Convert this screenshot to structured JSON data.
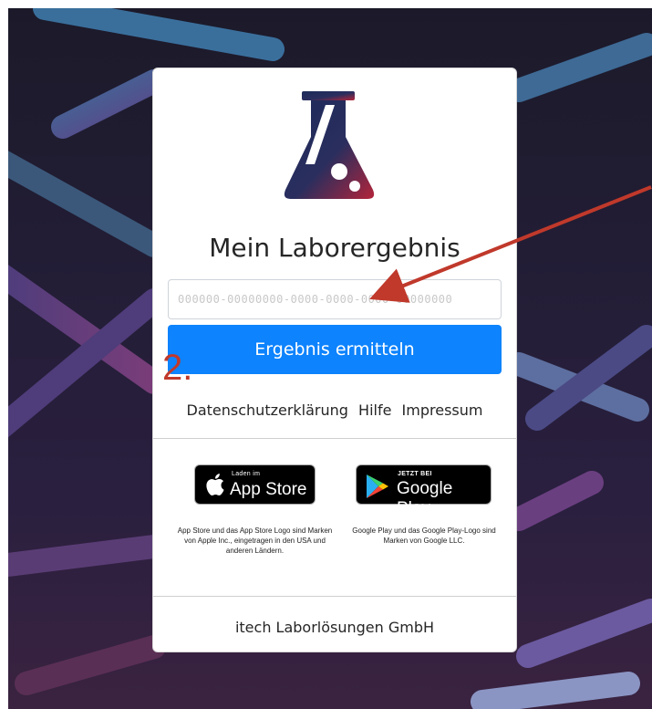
{
  "app": {
    "title": "Mein Laborergebnis"
  },
  "form": {
    "code_placeholder": "000000-00000000-0000-0000-0000-00000000",
    "code_value": "",
    "submit_label": "Ergebnis ermitteln"
  },
  "links": [
    {
      "label": "Datenschutzerklärung"
    },
    {
      "label": "Hilfe"
    },
    {
      "label": "Impressum"
    }
  ],
  "stores": {
    "apple": {
      "small": "Laden im",
      "big": "App Store",
      "disclaimer": "App Store und das App Store Logo sind Marken von Apple Inc., eingetragen in den USA und anderen Ländern."
    },
    "google": {
      "small": "JETZT BEI",
      "big": "Google Play",
      "disclaimer": "Google Play und das Google Play-Logo sind Marken von Google LLC."
    }
  },
  "footer": {
    "company": "itech Laborlösungen GmbH"
  },
  "annotation": {
    "step_number": "2.",
    "color": "#c0392b"
  },
  "icons": {
    "logo": "flask-icon",
    "apple": "apple-icon",
    "google": "google-play-icon"
  },
  "colors": {
    "accent": "#0d83fd",
    "background": "#221d35",
    "logo_gradient_start": "#1c2b5a",
    "logo_gradient_end": "#b3243a"
  }
}
